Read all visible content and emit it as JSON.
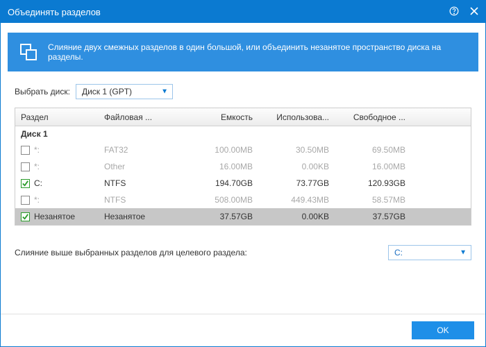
{
  "title": "Объединять разделов",
  "banner": "Слияние двух смежных разделов в один большой, или объединить незанятое пространство диска на разделы.",
  "disk_select": {
    "label": "Выбрать диск:",
    "value": "Диск 1 (GPT)"
  },
  "columns": {
    "partition": "Раздел",
    "filesystem": "Файловая ...",
    "capacity": "Емкость",
    "used": "Использова...",
    "free": "Свободное ..."
  },
  "group": "Диск 1",
  "rows": [
    {
      "checked": false,
      "enabled": false,
      "selected": false,
      "label": "*:",
      "fs": "FAT32",
      "cap": "100.00MB",
      "used": "30.50MB",
      "free": "69.50MB"
    },
    {
      "checked": false,
      "enabled": false,
      "selected": false,
      "label": "*:",
      "fs": "Other",
      "cap": "16.00MB",
      "used": "0.00KB",
      "free": "16.00MB"
    },
    {
      "checked": true,
      "enabled": true,
      "selected": false,
      "label": "C:",
      "fs": "NTFS",
      "cap": "194.70GB",
      "used": "73.77GB",
      "free": "120.93GB"
    },
    {
      "checked": false,
      "enabled": false,
      "selected": false,
      "label": "*:",
      "fs": "NTFS",
      "cap": "508.00MB",
      "used": "449.43MB",
      "free": "58.57MB"
    },
    {
      "checked": true,
      "enabled": true,
      "selected": true,
      "label": "Незанятое",
      "fs": "Незанятое",
      "cap": "37.57GB",
      "used": "0.00KB",
      "free": "37.57GB"
    }
  ],
  "merge_target": {
    "label": "Слияние выше выбранных разделов для целевого раздела:",
    "value": "C:"
  },
  "buttons": {
    "ok": "OK"
  }
}
